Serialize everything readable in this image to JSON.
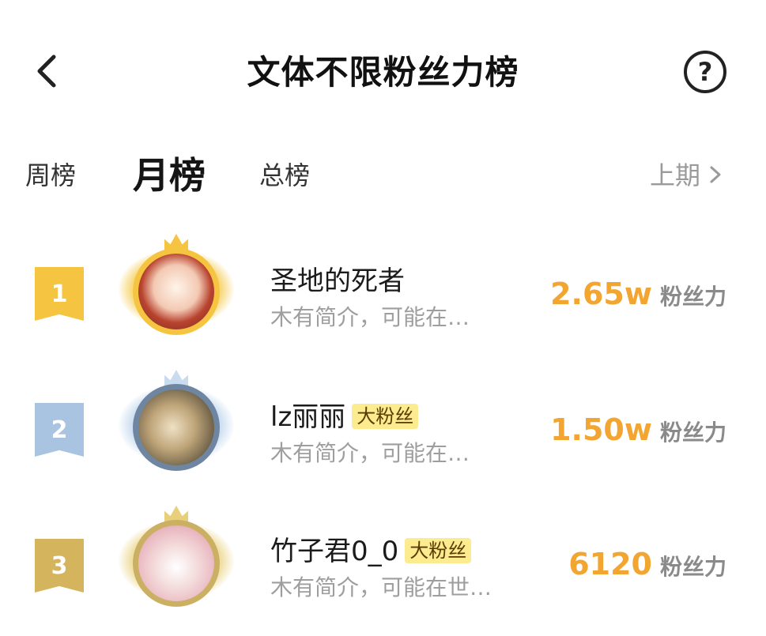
{
  "header": {
    "title": "文体不限粉丝力榜",
    "back_icon": "chevron-left-icon",
    "help_label": "?",
    "help_icon": "question-circle-icon"
  },
  "tabs": {
    "week": "周榜",
    "month": "月榜",
    "total": "总榜",
    "active": "month",
    "prev_period": "上期"
  },
  "colors": {
    "score": "#f2a531",
    "rank1": "#f5c542",
    "rank2": "#a8c4e0",
    "rank3": "#d4b45c",
    "fan_tag_bg": "#fdeb8f"
  },
  "ranking": [
    {
      "rank": "1",
      "name": "圣地的死者",
      "tag": "",
      "intro": "木有简介，可能在…",
      "score": "2.65w",
      "unit": "粉丝力"
    },
    {
      "rank": "2",
      "name": "lz丽丽",
      "tag": "大粉丝",
      "intro": "木有简介，可能在…",
      "score": "1.50w",
      "unit": "粉丝力"
    },
    {
      "rank": "3",
      "name": "竹子君0_0",
      "tag": "大粉丝",
      "intro": "木有简介，可能在世…",
      "score": "6120",
      "unit": "粉丝力"
    }
  ]
}
